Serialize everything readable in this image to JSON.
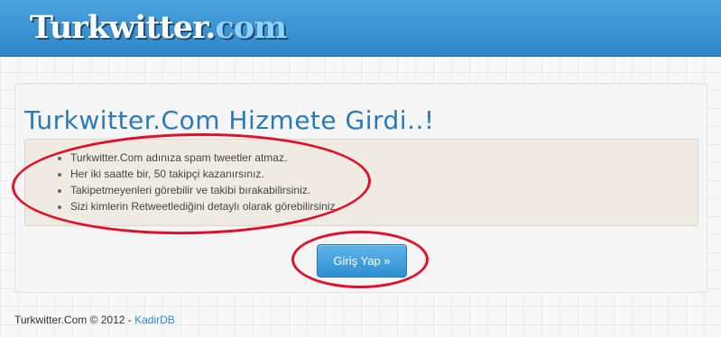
{
  "header": {
    "logo_main": "Turkwitter",
    "logo_dot": ".",
    "logo_tld": "com"
  },
  "main": {
    "headline": "Turkwitter.Com Hizmete Girdi..!",
    "features": [
      "Turkwitter.Com adınıza spam tweetler atmaz.",
      "Her iki saatte bir, 50 takipçi kazanırsınız.",
      "Takipetmeyenleri görebilir ve takibi bırakabilirsiniz.",
      "Sizi kimlerin Retweetlediğini detaylı olarak görebilirsiniz."
    ],
    "login_button": "Giriş Yap »"
  },
  "footer": {
    "copyright": "Turkwitter.Com © 2012 - ",
    "author_link": "KadirDB"
  },
  "colors": {
    "header_bg": "#3996d6",
    "accent": "#2a7ab8",
    "annotation": "#e0102b"
  }
}
